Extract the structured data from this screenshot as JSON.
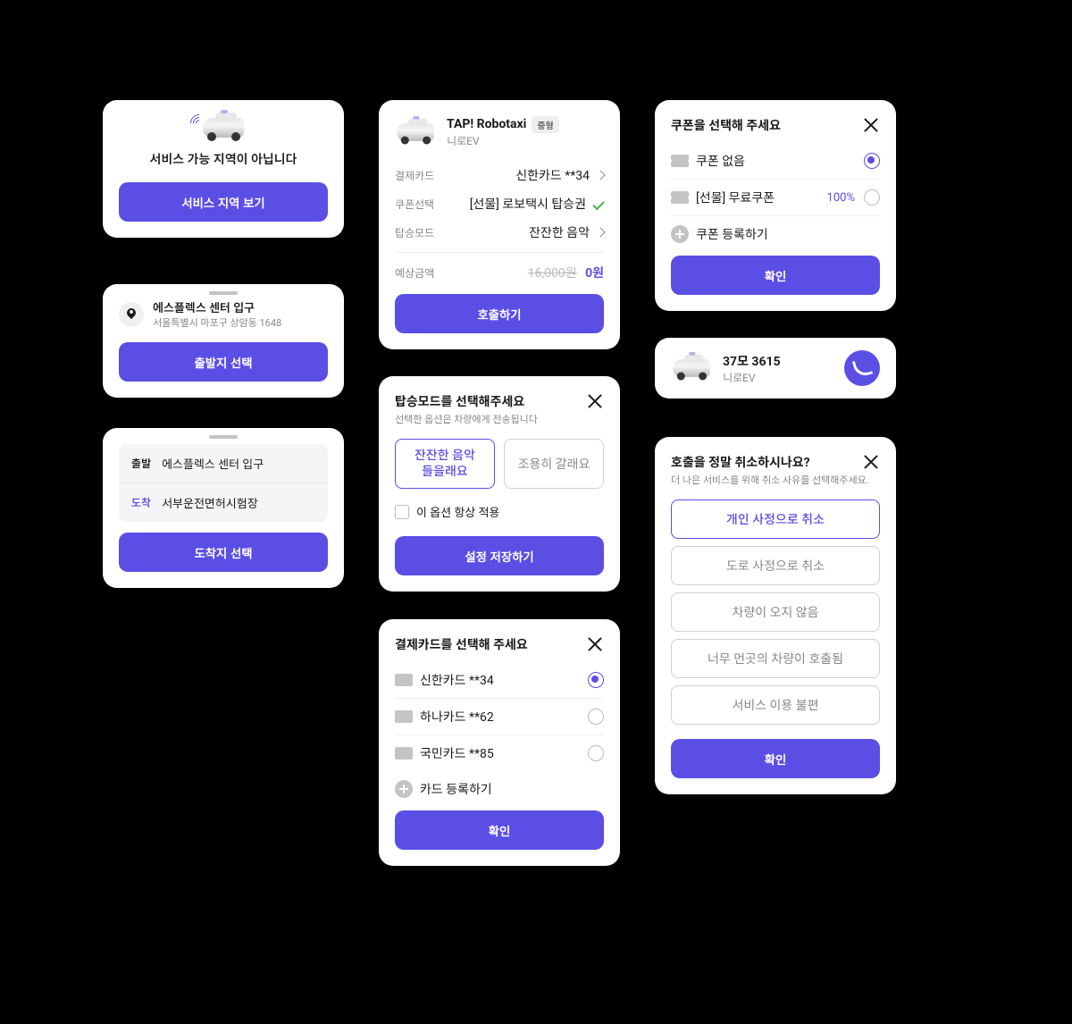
{
  "serviceArea": {
    "title": "서비스 가능 지역이 아닙니다",
    "button": "서비스 지역 보기"
  },
  "departPick": {
    "placeName": "에스플렉스 센터 입구",
    "address": "서울특별시 마포구 상암동 1648",
    "button": "출발지 선택"
  },
  "route": {
    "departLabel": "출발",
    "departValue": "에스플렉스 센터 입구",
    "arriveLabel": "도착",
    "arriveValue": "서부운전면허시험장",
    "button": "도착지 선택"
  },
  "booking": {
    "name": "TAP! Robotaxi",
    "badge": "중형",
    "model": "니로EV",
    "payLabel": "결제카드",
    "payValue": "신한카드 **34",
    "couponLabel": "쿠폰선택",
    "couponValue": "[선물] 로보택시 탑승권",
    "modeLabel": "탑승모드",
    "modeValue": "잔잔한 음악",
    "estLabel": "예상금액",
    "estOriginal": "16,000원",
    "estFinal": "0원",
    "button": "호출하기"
  },
  "rideMode": {
    "title": "탑승모드를 선택해주세요",
    "subtitle": "선택한 옵션은 차량에게 전송됩니다",
    "opt1a": "잔잔한 음악",
    "opt1b": "들을래요",
    "opt2": "조용히 갈래요",
    "always": "이 옵션 항상 적용",
    "button": "설정 저장하기"
  },
  "payCard": {
    "title": "결제카드를 선택해 주세요",
    "cards": [
      {
        "label": "신한카드 **34",
        "selected": true
      },
      {
        "label": "하나카드 **62",
        "selected": false
      },
      {
        "label": "국민카드 **85",
        "selected": false
      }
    ],
    "register": "카드 등록하기",
    "button": "확인"
  },
  "coupon": {
    "title": "쿠폰을 선택해 주세요",
    "none": "쿠폰 없음",
    "giftLabel": "[선물] 무료쿠폰",
    "giftValue": "100%",
    "register": "쿠폰 등록하기",
    "button": "확인"
  },
  "vehicle": {
    "plate": "37모 3615",
    "model": "니로EV"
  },
  "cancel": {
    "title": "호출을 정말 취소하시나요?",
    "subtitle": "더 나은 서비스를 위해 취소 사유를 선택해주세요.",
    "reasons": [
      "개인 사정으로 취소",
      "도로 사정으로 취소",
      "차량이 오지 않음",
      "너무 먼곳의 차량이 호출됨",
      "서비스 이용 불편"
    ],
    "button": "확인"
  }
}
